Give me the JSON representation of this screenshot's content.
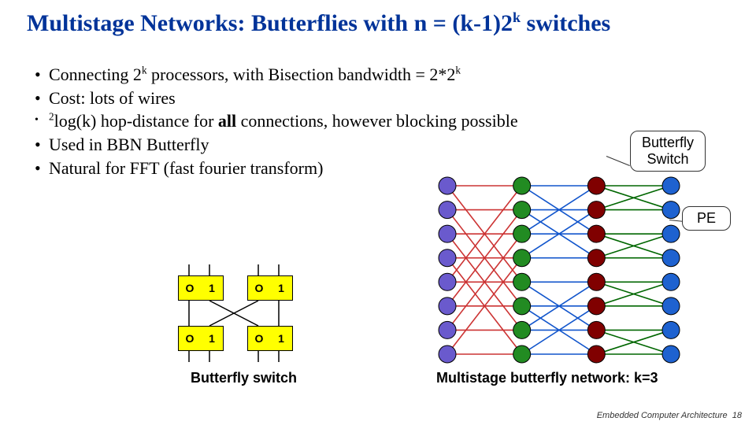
{
  "title": {
    "pre": "Multistage Networks: Butterflies with n = (k-1)2",
    "exp": "k",
    "post": " switches"
  },
  "bullets": {
    "b1": {
      "pre": "Connecting 2",
      "exp": "k",
      "mid": " processors, with Bisection bandwidth = 2*2",
      "exp2": "k"
    },
    "b2": "Cost: lots of wires",
    "b3": {
      "exp": "2",
      "pre": "log(k) hop-distance for ",
      "bold": "all",
      "post": " connections, however blocking possible"
    },
    "b4": "Used in BBN Butterfly",
    "b5": "Natural for FFT (fast fourier transform)"
  },
  "callouts": {
    "switch_l1": "Butterfly",
    "switch_l2": "Switch",
    "pe": "PE"
  },
  "switch_cell": {
    "left": "O",
    "right": "1"
  },
  "captions": {
    "left": "Butterfly switch",
    "right": "Multistage butterfly network: k=3"
  },
  "footer": {
    "text": "Embedded Computer Architecture",
    "page": "18"
  },
  "network": {
    "k": 3,
    "rows": 8,
    "stage_colors": [
      "#6a5acd",
      "#228b22",
      "#800000",
      "#1e62d0"
    ],
    "line_colors": {
      "01": "#cc3333",
      "12": "#1155cc",
      "23": "#006600"
    },
    "radius": 11
  }
}
